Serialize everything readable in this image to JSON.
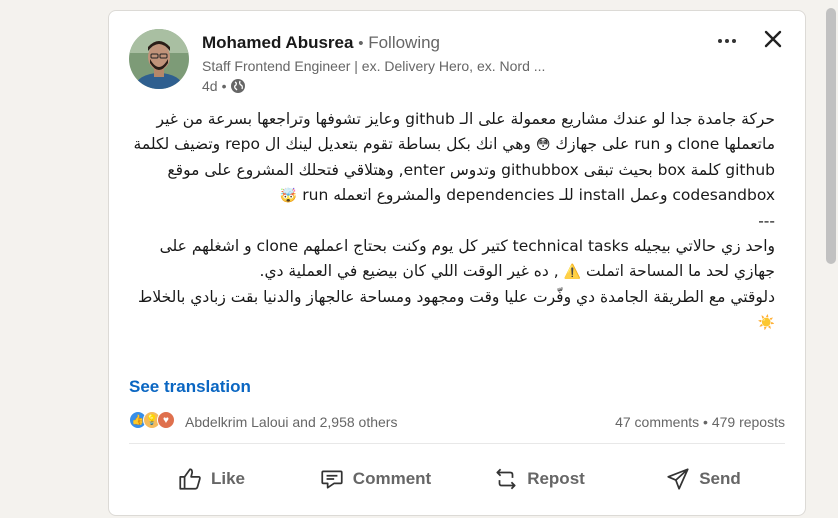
{
  "author": {
    "name": "Mohamed Abusrea",
    "separator": "•",
    "follow_status": "Following",
    "headline": "Staff Frontend Engineer | ex. Delivery Hero, ex. Nord ...",
    "time": "4d",
    "meta_separator": "•",
    "visibility_icon": "globe-icon"
  },
  "controls": {
    "more_icon": "more-horizontal-icon",
    "close_icon": "close-icon"
  },
  "post": {
    "paragraphs": [
      "حركة جامدة جدا لو عندك مشاريع معمولة على الـ github وعايز تشوفها وتراجعها بسرعة من غير ماتعملها clone و run على جهازك",
      "وهي انك بكل بساطة تقوم بتعديل لينك ال repo وتضيف لكلمة github كلمة box بحيث تبقى githubbox وتدوس enter, وهتلاقي فتحلك المشروع على موقع codesandbox وعمل install للـ dependencies والمشروع اتعمله run",
      "---",
      "واحد زي حالاتي بيجيله technical tasks كتير كل يوم وكنت بحتاج اعملهم clone و اشغلهم على جهازي لحد ما المساحة اتملت",
      ", ده غير الوقت اللي كان بيضيع في العملية دي.",
      "دلوقتي مع الطريقة الجامدة دي وفّرت عليا وقت ومجهود ومساحة عالجهاز والدنيا بقت زبادي بالخلاط"
    ],
    "emoji_1": "😳",
    "emoji_2": "🤯",
    "emoji_3": "⚠️",
    "emoji_4": "☀️",
    "see_translation": "See translation"
  },
  "social": {
    "reactions": [
      "like-icon",
      "insightful-icon",
      "love-icon"
    ],
    "reacted_by": "Abdelkrim Laloui and 2,958 others",
    "comments": "47 comments",
    "dot": "•",
    "reposts": "479 reposts"
  },
  "actions": [
    {
      "label": "Like",
      "icon": "like-icon"
    },
    {
      "label": "Comment",
      "icon": "comment-icon"
    },
    {
      "label": "Repost",
      "icon": "repost-icon"
    },
    {
      "label": "Send",
      "icon": "send-icon"
    }
  ],
  "colors": {
    "link": "#0a66c2",
    "background": "#f4f2ee",
    "card": "#ffffff",
    "muted_text": "#666666"
  }
}
